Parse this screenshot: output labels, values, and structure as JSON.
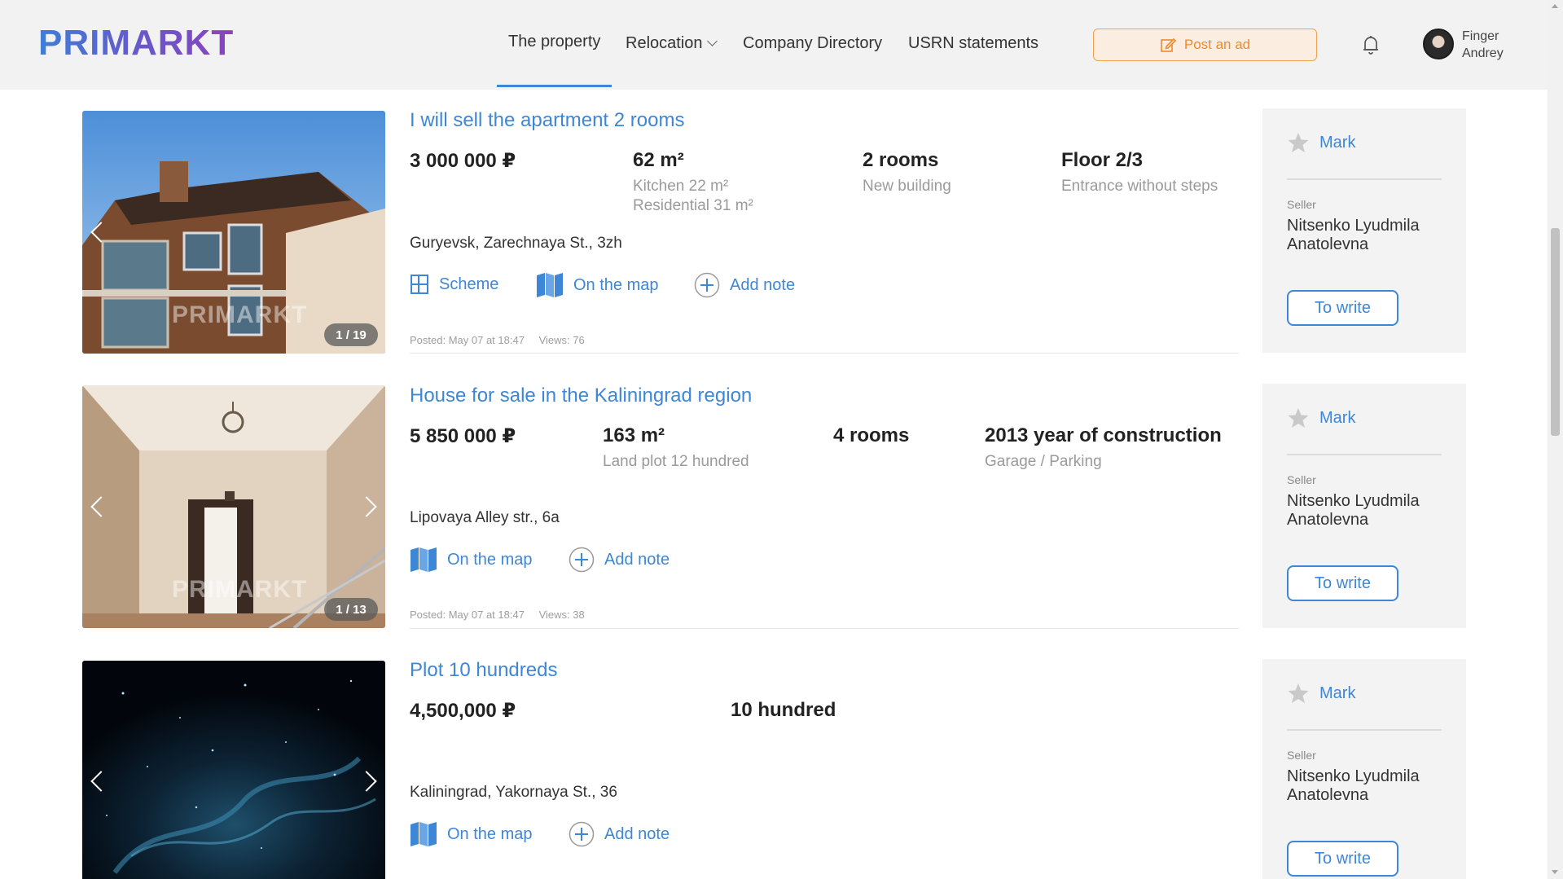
{
  "header": {
    "logo": "PRIMARKT",
    "nav": {
      "property": "The property",
      "relocation": "Relocation",
      "company_directory": "Company Directory",
      "usrn": "USRN statements"
    },
    "post_ad": "Post an ad",
    "user": {
      "first": "Finger",
      "last": "Andrey"
    }
  },
  "colors": {
    "accent": "#3e86d6",
    "orange": "#f08a2b",
    "logo_start": "#3d7fd6",
    "logo_end": "#8a43bf"
  },
  "listings": [
    {
      "title": "I will sell the apartment 2 rooms",
      "price": "3 000 000 ₽",
      "area": "62 m²",
      "area_sub1": "Kitchen 22 m²",
      "area_sub2": "Residential 31 m²",
      "rooms": "2 rooms",
      "rooms_sub": "New building",
      "extra": "Floor 2/3",
      "extra_sub": "Entrance without steps",
      "address": "Guryevsk, Zarechnaya St., 3zh",
      "scheme": "Scheme",
      "map": "On the map",
      "note": "Add note",
      "posted": "Posted: May 07 at 18:47",
      "views": "Views: 76",
      "counter": "1 / 19",
      "watermark": "PRIMARKT",
      "mark": "Mark",
      "seller_label": "Seller",
      "seller_name": "Nitsenko Lyudmila Anatolevna",
      "write": "To write"
    },
    {
      "title": "House for sale in the Kaliningrad region",
      "price": "5 850 000 ₽",
      "area": "163 m²",
      "area_sub1": "Land plot 12 hundred",
      "rooms": "4 rooms",
      "extra": "2013 year of construction",
      "extra_sub": "Garage / Parking",
      "address": "Lipovaya Alley str., 6a",
      "map": "On the map",
      "note": "Add note",
      "posted": "Posted: May 07 at 18:47",
      "views": "Views: 38",
      "counter": "1 / 13",
      "watermark": "PRIMARKT",
      "mark": "Mark",
      "seller_label": "Seller",
      "seller_name": "Nitsenko Lyudmila Anatolevna",
      "write": "To write"
    },
    {
      "title": "Plot 10 hundreds",
      "price": "4,500,000 ₽",
      "area": "10 hundred",
      "address": "Kaliningrad, Yakornaya St., 36",
      "map": "On the map",
      "note": "Add note",
      "mark": "Mark",
      "seller_label": "Seller",
      "seller_name": "Nitsenko Lyudmila Anatolevna",
      "write": "To write"
    }
  ]
}
